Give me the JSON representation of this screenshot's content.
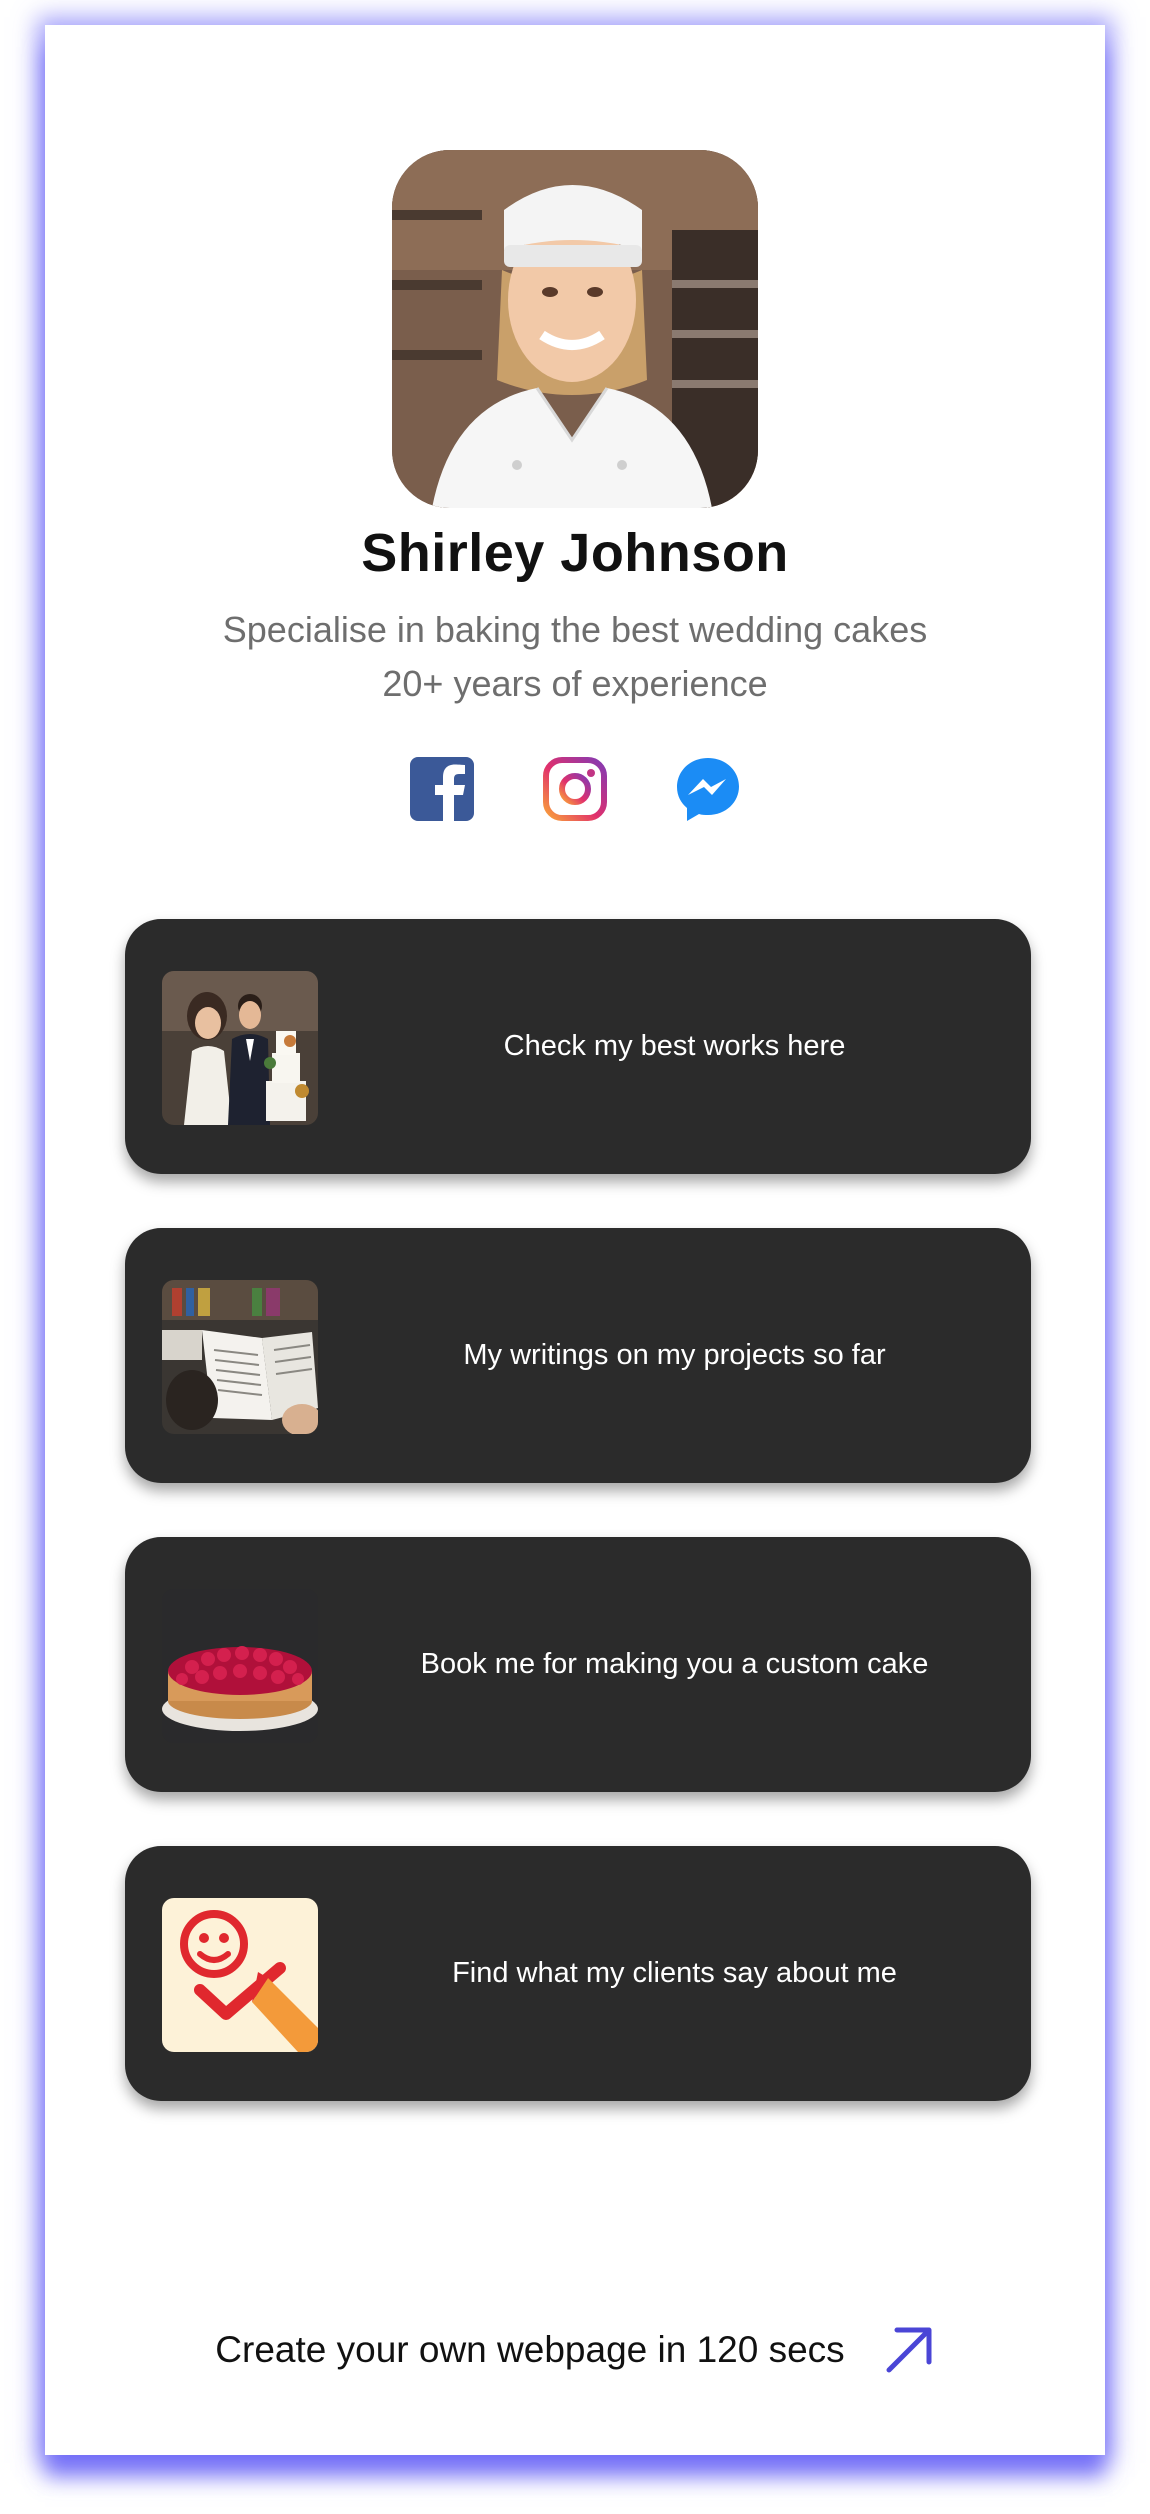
{
  "profile": {
    "name": "Shirley Johnson",
    "bio_line1": "Specialise in baking the best wedding cakes",
    "bio_line2": "20+ years of experience"
  },
  "social": [
    {
      "icon": "facebook-icon",
      "color": "#3b5998"
    },
    {
      "icon": "instagram-icon",
      "color": "#c13584"
    },
    {
      "icon": "messenger-icon",
      "color": "#1b8cf5"
    }
  ],
  "links": [
    {
      "label": "Check my best works here",
      "thumb": "wedding-couple-cake-thumbnail"
    },
    {
      "label": "My writings on my projects so far",
      "thumb": "reading-book-thumbnail"
    },
    {
      "label": "Book me for making you a custom cake",
      "thumb": "raspberry-cake-thumbnail"
    },
    {
      "label": "Find what my clients say about me",
      "thumb": "smiley-review-thumbnail"
    }
  ],
  "footer": {
    "text": "Create your own webpage in 120 secs",
    "icon": "arrow-up-right-icon",
    "accent": "#4a45d6"
  },
  "colors": {
    "card_shadow": "#5f5af5",
    "button_bg": "#2b2b2b",
    "bio_text": "#6e6e6e"
  }
}
